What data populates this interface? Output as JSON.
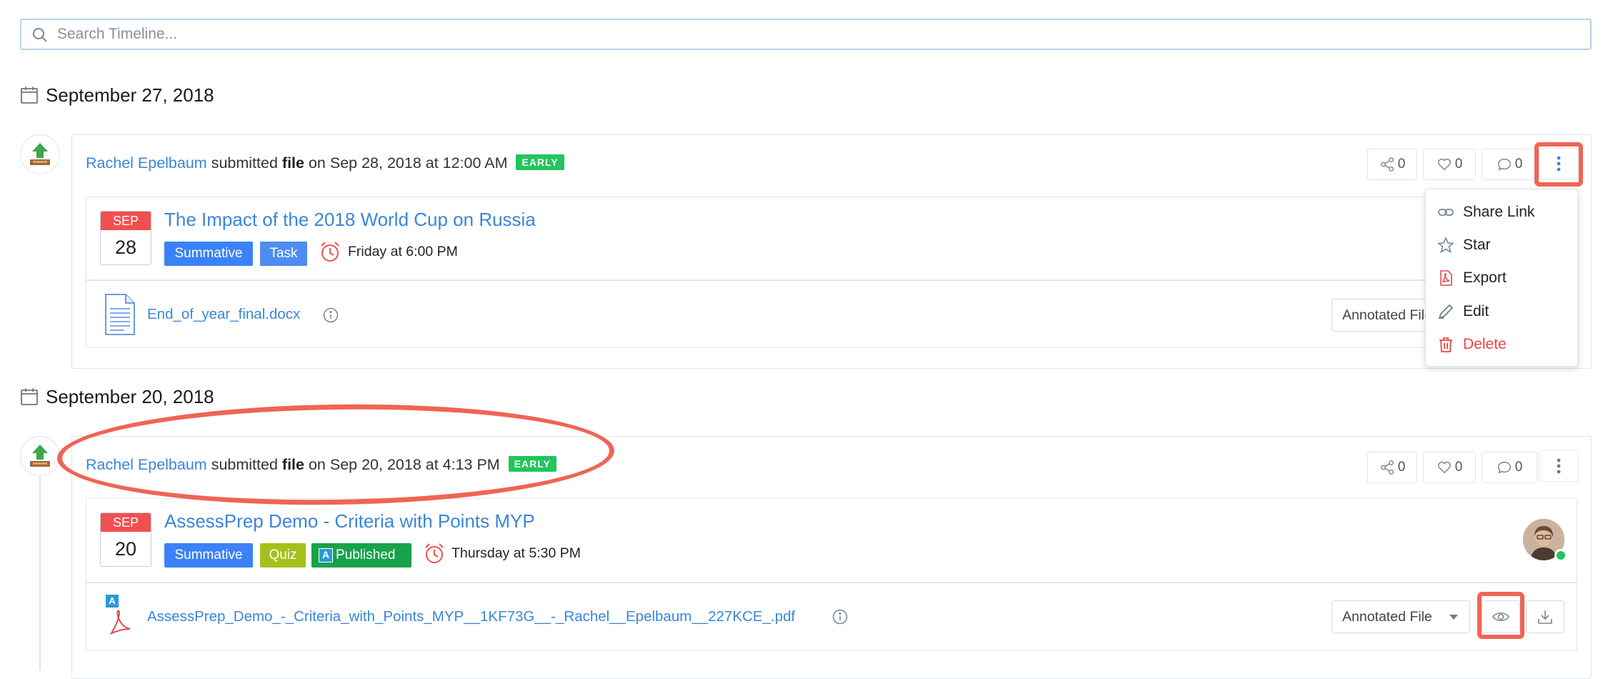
{
  "search": {
    "placeholder": "Search Timeline..."
  },
  "groups": [
    {
      "date": "September 27, 2018",
      "entry": {
        "user": "Rachel Epelbaum",
        "verb": "submitted",
        "object": "file",
        "when": "on Sep 28, 2018 at 12:00 AM",
        "badge": "EARLY",
        "shares": "0",
        "likes": "0",
        "comments": "0",
        "assessment": {
          "month": "SEP",
          "day": "28",
          "title": "The Impact of the 2018 World Cup on Russia",
          "tags": [
            "Summative",
            "Task"
          ],
          "due": "Friday at 6:00 PM"
        },
        "file": {
          "name": "End_of_year_final.docx",
          "view_mode": "Annotated File"
        }
      }
    },
    {
      "date": "September 20, 2018",
      "entry": {
        "user": "Rachel Epelbaum",
        "verb": "submitted",
        "object": "file",
        "when": "on Sep 20, 2018 at 4:13 PM",
        "badge": "EARLY",
        "shares": "0",
        "likes": "0",
        "comments": "0",
        "assessment": {
          "month": "SEP",
          "day": "20",
          "title": "AssessPrep Demo - Criteria with Points MYP",
          "tags": [
            "Summative",
            "Quiz",
            "Published"
          ],
          "published_letter": "A",
          "due": "Thursday at 5:30 PM"
        },
        "file": {
          "name": "AssessPrep_Demo_-_Criteria_with_Points_MYP__1KF73G__-_Rachel__Epelbaum__227KCE_.pdf",
          "view_mode": "Annotated File",
          "badge_letter": "A"
        }
      }
    }
  ],
  "menu": {
    "items": [
      {
        "label": "Share Link",
        "icon": "link-icon"
      },
      {
        "label": "Star",
        "icon": "star-icon"
      },
      {
        "label": "Export",
        "icon": "pdf-icon"
      },
      {
        "label": "Edit",
        "icon": "pencil-icon"
      },
      {
        "label": "Delete",
        "icon": "trash-icon"
      }
    ]
  },
  "colors": {
    "link": "#3a86d9",
    "early": "#22c55e",
    "summative": "#3b82f6",
    "task": "#4b8df0",
    "quiz": "#a3c11a",
    "published": "#16a34a",
    "date_red": "#f14f50",
    "highlight": "#f06455",
    "delete": "#ef4444"
  }
}
